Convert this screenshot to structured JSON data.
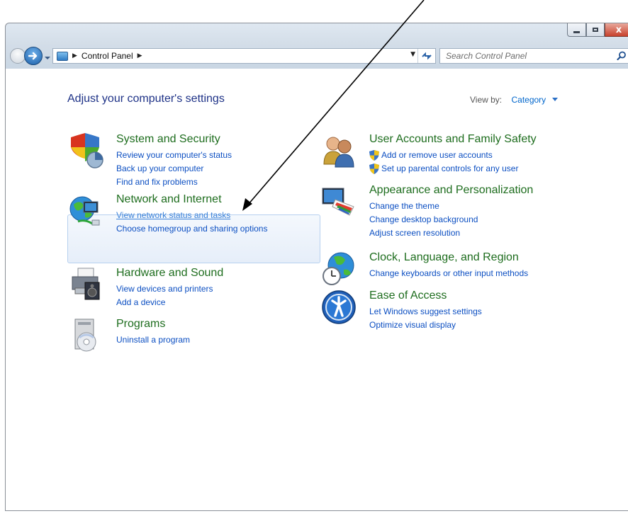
{
  "window": {
    "caption": {
      "minimize_icon": "minimize-icon",
      "maximize_icon": "maximize-icon",
      "close_glyph": "x"
    }
  },
  "nav": {
    "breadcrumb": [
      "Control Panel"
    ],
    "search_placeholder": "Search Control Panel"
  },
  "page": {
    "title": "Adjust your computer's settings",
    "view_by_label": "View by:",
    "view_by_value": "Category"
  },
  "categories": [
    {
      "title": "System and Security",
      "icon": "shield-icon",
      "links": [
        "Review your computer's status",
        "Back up your computer",
        "Find and fix problems"
      ]
    },
    {
      "title": "Network and Internet",
      "icon": "network-globe-icon",
      "links": [
        "View network status and tasks",
        "Choose homegroup and sharing options"
      ]
    },
    {
      "title": "Hardware and Sound",
      "icon": "printer-speaker-icon",
      "links": [
        "View devices and printers",
        "Add a device"
      ]
    },
    {
      "title": "Programs",
      "icon": "programs-disc-icon",
      "links": [
        "Uninstall a program"
      ]
    },
    {
      "title": "User Accounts and Family Safety",
      "icon": "users-icon",
      "links": [
        "Add or remove user accounts",
        "Set up parental controls for any user"
      ]
    },
    {
      "title": "Appearance and Personalization",
      "icon": "monitor-palette-icon",
      "links": [
        "Change the theme",
        "Change desktop background",
        "Adjust screen resolution"
      ]
    },
    {
      "title": "Clock, Language, and Region",
      "icon": "globe-clock-icon",
      "links": [
        "Change keyboards or other input methods"
      ]
    },
    {
      "title": "Ease of Access",
      "icon": "ease-of-access-icon",
      "links": [
        "Let Windows suggest settings",
        "Optimize visual display"
      ]
    }
  ],
  "colors": {
    "category_title": "#1e6d1e",
    "link": "#0c4fc2",
    "page_title": "#1e3287"
  }
}
